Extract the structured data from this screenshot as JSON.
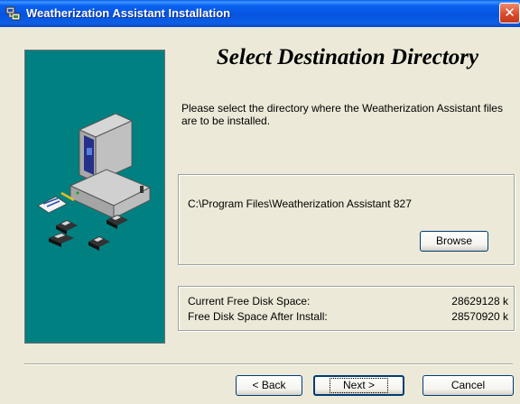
{
  "window": {
    "title": "Weatherization Assistant Installation",
    "close_icon": "close-icon"
  },
  "page": {
    "heading": "Select Destination Directory",
    "description": "Please select the directory where the Weatherization Assistant files are to be installed."
  },
  "destination": {
    "path": "C:\\Program Files\\Weatherization Assistant 827",
    "browse_label": "Browse"
  },
  "disk": {
    "current_free_label": "Current Free Disk Space:",
    "current_free_value": "28629128 k",
    "after_install_label": "Free Disk Space After Install:",
    "after_install_value": "28570920 k"
  },
  "buttons": {
    "back_label": "< Back",
    "next_label": "Next >",
    "cancel_label": "Cancel"
  },
  "colors": {
    "art_background": "#008080",
    "title_bar": "#0554e0",
    "dialog_face": "#ece9d8"
  },
  "icons": [
    "installer-icon",
    "close-icon",
    "computer-icon",
    "floppy-disk-icon",
    "document-pen-icon"
  ]
}
